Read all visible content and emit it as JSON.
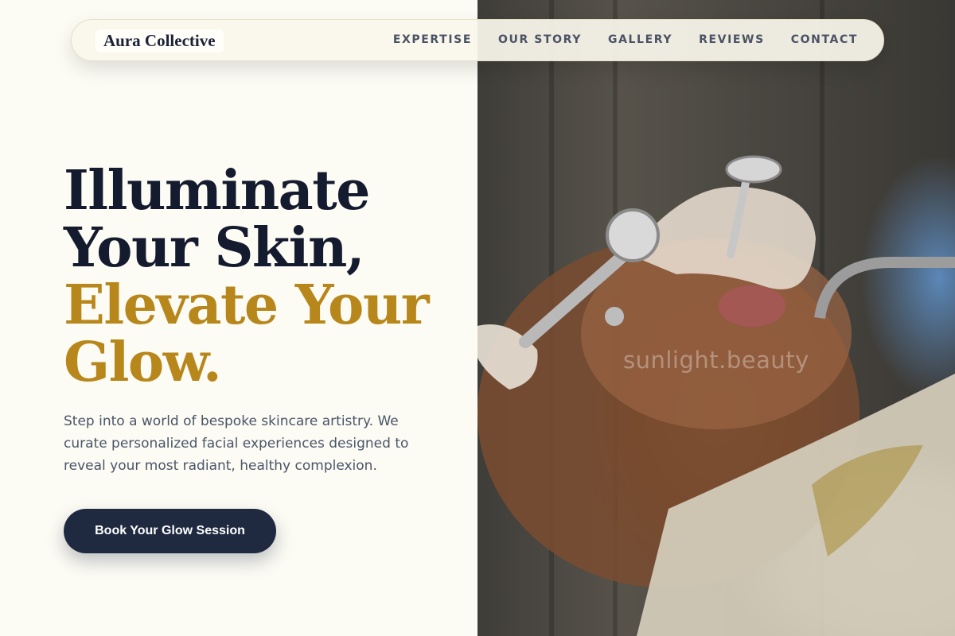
{
  "brand": {
    "name": "Aura Collective"
  },
  "nav": {
    "items": [
      {
        "label": "EXPERTISE"
      },
      {
        "label": "OUR STORY"
      },
      {
        "label": "GALLERY"
      },
      {
        "label": "REVIEWS"
      },
      {
        "label": "CONTACT"
      }
    ]
  },
  "hero": {
    "title_line1": "Illuminate",
    "title_line2": "Your Skin,",
    "title_line3": "Elevate Your",
    "title_line4": "Glow.",
    "description": "Step into a world of bespoke skincare artistry. We curate personalized facial experiences designed to reveal your most radiant, healthy complexion.",
    "cta_label": "Book Your Glow Session"
  },
  "photo": {
    "watermark": "sunlight.beauty"
  },
  "colors": {
    "background": "#fcfbf4",
    "dark_navy": "#141b2e",
    "gold_accent": "#b8871b",
    "button_bg": "#1f2a41",
    "nav_text": "#4a5364"
  }
}
